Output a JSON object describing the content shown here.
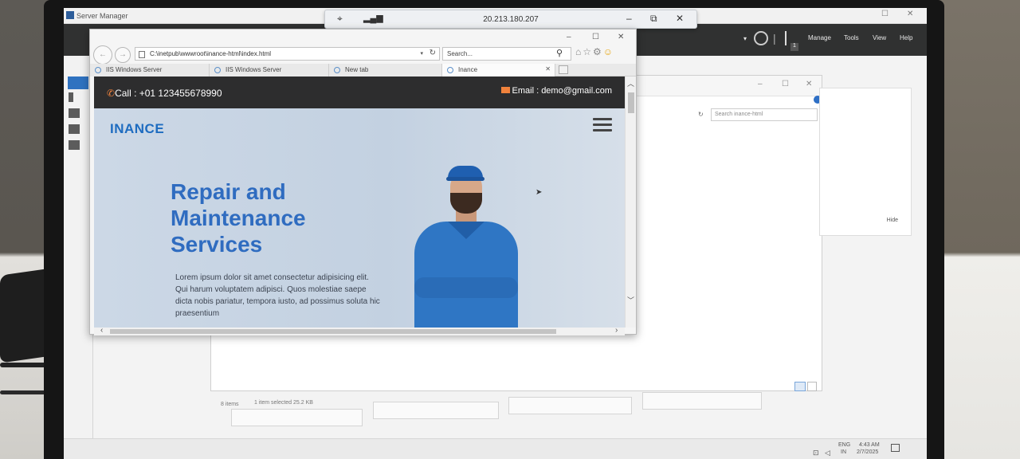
{
  "server_manager": {
    "title": "Server Manager",
    "menu": [
      "Manage",
      "Tools",
      "View",
      "Help"
    ],
    "flag_badge": "1"
  },
  "rdp_bar": {
    "ip": "20.213.180.207"
  },
  "browser": {
    "address": "C:\\inetpub\\wwwroot\\inance-html\\index.html",
    "search_placeholder": "Search...",
    "tabs": [
      {
        "label": "IIS Windows Server"
      },
      {
        "label": "IIS Windows Server"
      },
      {
        "label": "New tab"
      },
      {
        "label": "Inance"
      }
    ]
  },
  "website": {
    "call": "Call : +01 123455678990",
    "email": "Email : demo@gmail.com",
    "brand": "INANCE",
    "headline": "Repair and Maintenance Services",
    "body_text": "Lorem ipsum dolor sit amet consectetur adipisicing elit. Qui harum voluptatem adipisci. Quos molestiae saepe dicta nobis pariatur, tempora iusto, ad possimus soluta hic praesentium"
  },
  "explorer": {
    "search_placeholder": "Search inance-html",
    "status_items": "8 items",
    "status_selected": "1 item selected  25.2 KB",
    "hide_label": "Hide"
  },
  "taskbar": {
    "lang": "ENG",
    "region": "IN",
    "time": "4:43 AM",
    "date": "2/7/2025"
  },
  "colors": {
    "brand_blue": "#2f6cc0",
    "topbar_dark": "#2d2d2e",
    "accent_orange": "#f0823c",
    "server_manager_bar": "#303131"
  }
}
